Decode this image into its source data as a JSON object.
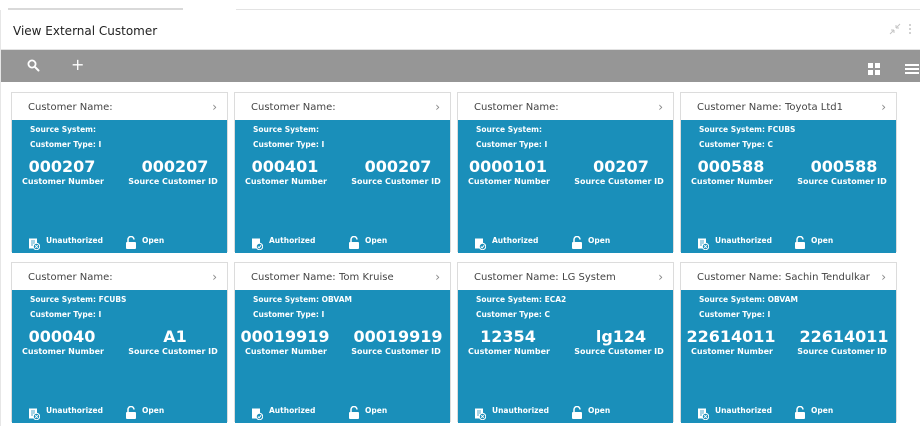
{
  "window": {
    "title": "View External Customer",
    "minimize_icon": "minimize-icon",
    "close_icon": "close-icon"
  },
  "toolbar": {
    "search_icon": "search-icon",
    "add_label": "+",
    "grid_icon": "grid-view-icon",
    "list_icon": "list-view-icon"
  },
  "labels": {
    "customer_name": "Customer Name:",
    "source_system": "Source System:",
    "customer_type": "Customer Type:",
    "customer_number": "Customer Number",
    "source_customer_id": "Source Customer ID",
    "open": "Open"
  },
  "colors": {
    "card_body": "#1a8fba",
    "toolbar": "#969696"
  },
  "cards": [
    {
      "name": "",
      "source_system": "",
      "customer_type": "I",
      "customer_number": "000207",
      "source_customer_id": "000207",
      "status": "Unauthorized",
      "record_status": "Open"
    },
    {
      "name": "",
      "source_system": "",
      "customer_type": "I",
      "customer_number": "000401",
      "source_customer_id": "000207",
      "status": "Authorized",
      "record_status": "Open"
    },
    {
      "name": "",
      "source_system": "",
      "customer_type": "I",
      "customer_number": "0000101",
      "source_customer_id": "00207",
      "status": "Authorized",
      "record_status": "Open"
    },
    {
      "name": "Toyota Ltd1",
      "source_system": "FCUBS",
      "customer_type": "C",
      "customer_number": "000588",
      "source_customer_id": "000588",
      "status": "Unauthorized",
      "record_status": "Open"
    },
    {
      "name": "",
      "source_system": "FCUBS",
      "customer_type": "I",
      "customer_number": "000040",
      "source_customer_id": "A1",
      "status": "Unauthorized",
      "record_status": "Open"
    },
    {
      "name": "Tom Kruise",
      "source_system": "OBVAM",
      "customer_type": "I",
      "customer_number": "00019919",
      "source_customer_id": "00019919",
      "status": "Authorized",
      "record_status": "Open"
    },
    {
      "name": "LG System",
      "source_system": "ECA2",
      "customer_type": "C",
      "customer_number": "12354",
      "source_customer_id": "lg124",
      "status": "Unauthorized",
      "record_status": "Open"
    },
    {
      "name": "Sachin Tendulkar",
      "source_system": "OBVAM",
      "customer_type": "I",
      "customer_number": "22614011",
      "source_customer_id": "22614011",
      "status": "Unauthorized",
      "record_status": "Open"
    }
  ]
}
